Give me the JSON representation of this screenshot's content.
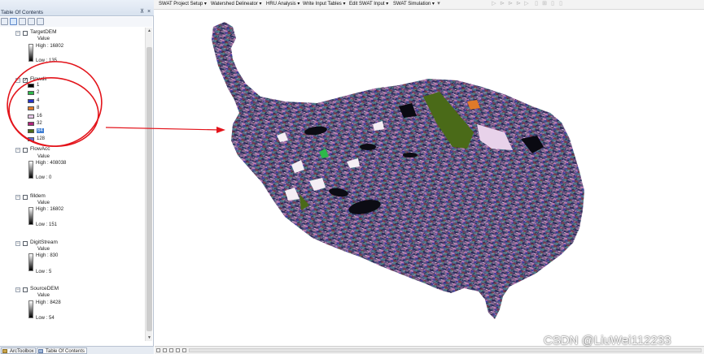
{
  "toc": {
    "title": "Table Of Contents",
    "pin_icon": "pin-icon",
    "close_icon": "close-icon",
    "layers": [
      {
        "name": "TargetDEM",
        "value_label": "Value",
        "high": "High : 16802",
        "low": "Low : 135"
      },
      {
        "name": "Flowdir",
        "classes": [
          {
            "label": "1",
            "color": "#000000"
          },
          {
            "label": "2",
            "color": "#2db84a"
          },
          {
            "label": "4",
            "color": "#2432c8"
          },
          {
            "label": "8",
            "color": "#e07a2a"
          },
          {
            "label": "16",
            "color": "#e6c6e6"
          },
          {
            "label": "32",
            "color": "#b0247c"
          },
          {
            "label": "64",
            "color": "#4a6a18"
          },
          {
            "label": "128",
            "color": "#5a6ed8"
          }
        ]
      },
      {
        "name": "FlowAcc",
        "value_label": "Value",
        "high": "High : 408038",
        "low": "Low : 0"
      },
      {
        "name": "filldem",
        "value_label": "Value",
        "high": "High : 16802",
        "low": "Low : 151"
      },
      {
        "name": "DigitStream",
        "value_label": "Value",
        "high": "High : 830",
        "low": "Low : 5"
      },
      {
        "name": "SourceDEM",
        "value_label": "Value",
        "high": "High : 8428",
        "low": "Low : 54"
      }
    ],
    "tabs": [
      "ArcToolbox",
      "Table Of Contents"
    ]
  },
  "swat_menu": [
    "SWAT Project Setup ▾",
    "Watershed Delineator ▾",
    "HRU Analysis ▾",
    "Write Input Tables ▾",
    "Edit SWAT Input ▾",
    "SWAT Simulation ▾"
  ],
  "watermark": "CSDN @LiuWei112233",
  "colors": {
    "annotation": "#e3141b",
    "map_palette": [
      "#6a4a8a",
      "#2b2e5e",
      "#8d6b8e",
      "#4d7a8c",
      "#c07bb2",
      "#3a3aa0",
      "#7a3a4a",
      "#5c9a6a",
      "#d9c3d9",
      "#2a1a2a"
    ]
  }
}
